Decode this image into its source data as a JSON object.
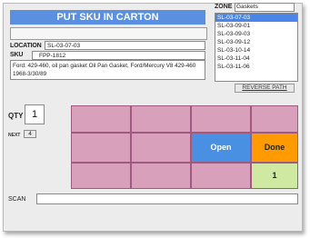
{
  "screen": {
    "title": "PUT SKU IN CARTON",
    "location_label": "LOCATION",
    "location_value": "SL-03-07-03",
    "sku_label": "SKU",
    "sku_value": "FPP-1812",
    "description": "Ford: 429-460, oil pan gasket Oil Pan Gasket, Ford/Mercury V8 429-460 1968-3/30/89"
  },
  "zone": {
    "label": "ZONE",
    "value": "Gaskets"
  },
  "locations": [
    {
      "label": "SL-03-07-03",
      "selected": true
    },
    {
      "label": "SL-03-09-01",
      "selected": false
    },
    {
      "label": "SL-03-09-03",
      "selected": false
    },
    {
      "label": "SL-03-09-12",
      "selected": false
    },
    {
      "label": "SL-03-10-14",
      "selected": false
    },
    {
      "label": "SL-03-11-04",
      "selected": false
    },
    {
      "label": "SL-03-11-06",
      "selected": false
    }
  ],
  "reverse_path_label": "REVERSE PATH",
  "qty": {
    "label": "QTY",
    "value": "1",
    "next_label": "NEXT",
    "next_value": "4"
  },
  "buttons": {
    "open_label": "Open",
    "done_label": "Done",
    "one_label": "1"
  },
  "scan": {
    "label": "SCAN",
    "value": ""
  },
  "colors": {
    "title_bar": "#5b8fe0",
    "grid_pink": "#d9a0bc",
    "open_blue": "#4a90e2",
    "done_orange": "#ff9a00",
    "one_green": "#cfe8a2",
    "list_selected": "#4a86e8"
  }
}
